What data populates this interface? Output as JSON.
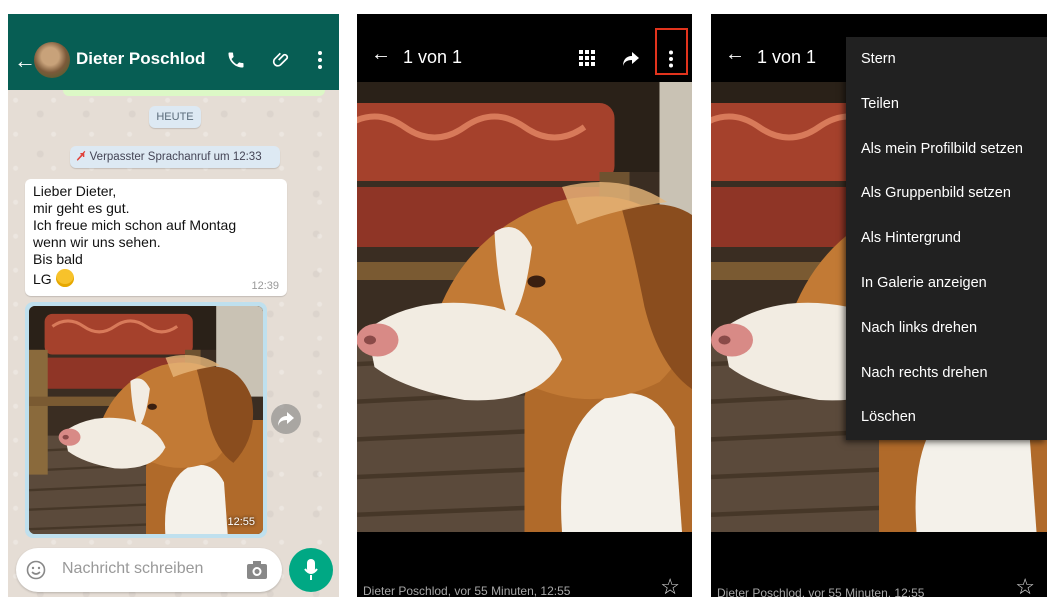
{
  "chat": {
    "contact_name": "Dieter Poschlod",
    "date_label": "HEUTE",
    "missed_call": "Verpasster Sprachanruf um 12:33",
    "message": {
      "lines": [
        "Lieber Dieter,",
        "mir geht es gut.",
        "Ich freue mich schon auf Montag",
        "wenn wir uns sehen.",
        "Bis bald",
        "LG"
      ],
      "time": "12:39"
    },
    "image_time": "12:55",
    "input_placeholder": "Nachricht schreiben",
    "colors": {
      "header": "#075e54",
      "accent": "#00a884"
    }
  },
  "viewer": {
    "counter": "1 von 1",
    "caption": "Dieter Poschlod, vor 55 Minuten, 12:55"
  },
  "menu": {
    "items": [
      "Stern",
      "Teilen",
      "Als mein Profilbild setzen",
      "Als Gruppenbild setzen",
      "Als Hintergrund",
      "In Galerie anzeigen",
      "Nach links drehen",
      "Nach rechts drehen",
      "Löschen"
    ]
  },
  "icons": [
    "back-arrow-icon",
    "phone-icon",
    "paperclip-icon",
    "more-vert-icon",
    "grid-icon",
    "share-icon",
    "star-icon",
    "emoji-icon",
    "camera-icon",
    "mic-icon",
    "forward-icon",
    "missed-call-icon"
  ],
  "highlight_color": "#e2341d"
}
